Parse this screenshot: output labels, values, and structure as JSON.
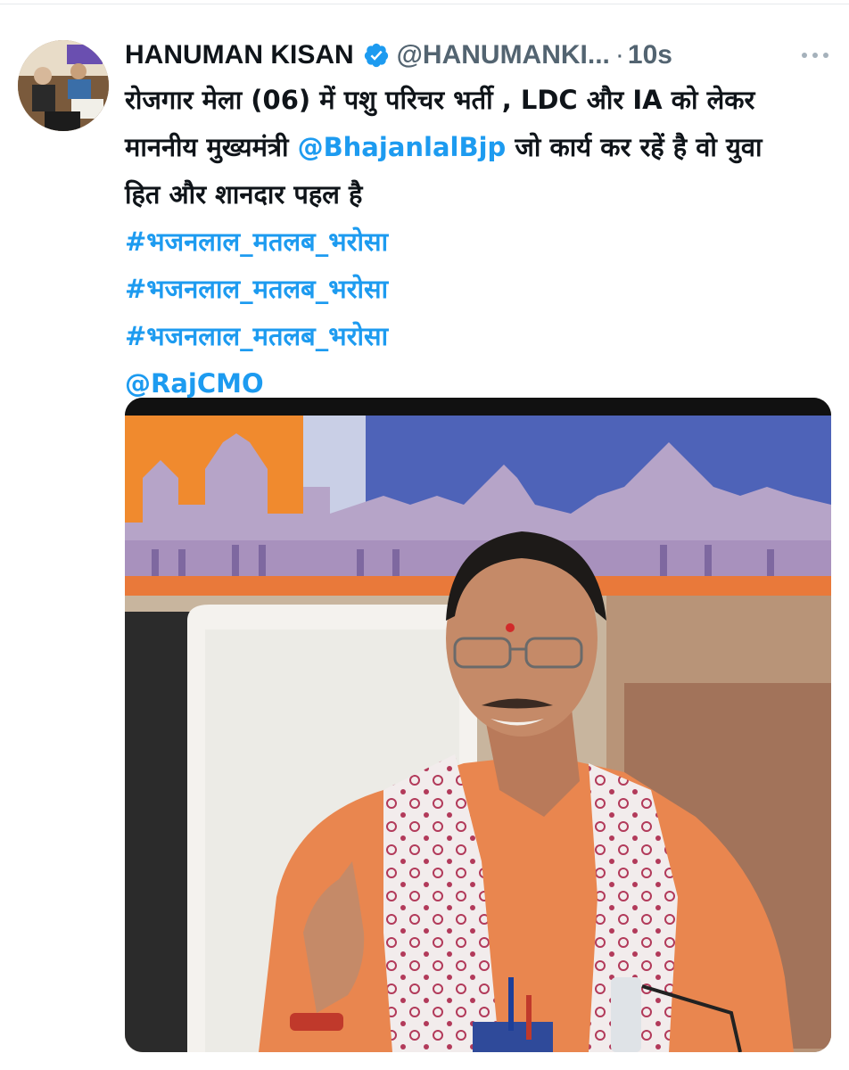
{
  "tweet": {
    "author_name": "HANUMAN KISAN",
    "handle": "@HANUMANKI...",
    "separator": "·",
    "time": "10s",
    "verified_icon": "verified-badge-icon",
    "more_icon": "more-options-icon",
    "text_line1": "रोजगार मेला (06) में पशु परिचर भर्ती , LDC और IA को लेकर",
    "text_line2_pre": "माननीय मुख्यमंत्री ",
    "mention1": "@BhajanlalBjp",
    "text_line2_post": " जो कार्य कर रहें है वो युवा",
    "text_line3": "हित और शानदार पहल है",
    "hashtags": [
      "#भजनलाल_मतलब_भरोसा",
      "#भजनलाल_मतलब_भरोसा",
      "#भजनलाल_मतलब_भरोसा"
    ],
    "mention2": "@RajCMO"
  },
  "colors": {
    "link": "#1d9bf0",
    "text": "#0f1419",
    "secondary": "#536471",
    "verified": "#1d9bf0"
  }
}
